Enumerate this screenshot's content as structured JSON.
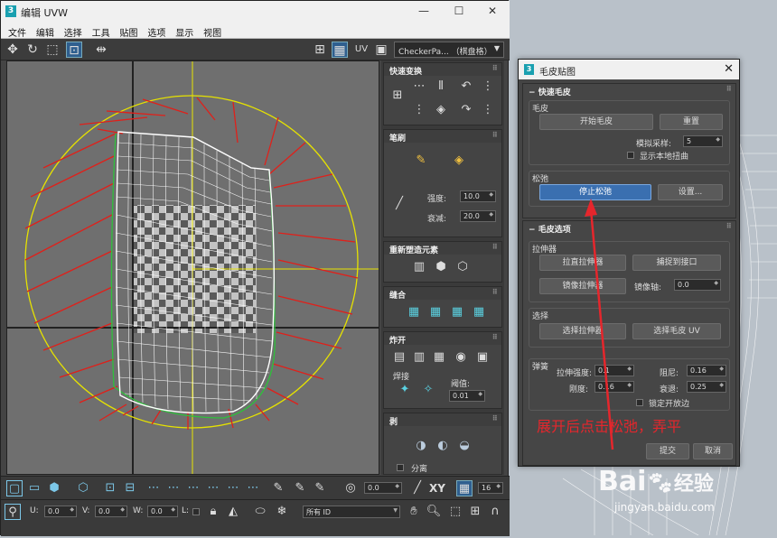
{
  "uvw": {
    "title": "编辑 UVW",
    "menu": [
      "文件",
      "编辑",
      "选择",
      "工具",
      "贴图",
      "选项",
      "显示",
      "视图"
    ],
    "toolbar": {
      "uv_label": "UV",
      "texture": "CheckerPa... （棋盘格）"
    }
  },
  "rollouts": {
    "quick_transform": "快速变换",
    "brush": "笔刷",
    "strength_label": "强度:",
    "strength_value": "10.0",
    "falloff_label": "衰减:",
    "falloff_value": "20.0",
    "rearrange": "重新塑造元素",
    "stitch": "缝合",
    "explode": "炸开",
    "weld_label": "焊接",
    "threshold_label": "阈值:",
    "threshold_value": "0.01",
    "peel": "剥",
    "detach_label": "分离"
  },
  "bottom": {
    "angle_value": "0.0",
    "xy_label": "XY",
    "grid_value": "16",
    "u_label": "U:",
    "u_value": "0.0",
    "v_label": "V:",
    "v_value": "0.0",
    "w_label": "W:",
    "w_value": "0.0",
    "l_label": "L:",
    "id_select": "所有 ID"
  },
  "peel_dialog": {
    "title": "毛皮贴图",
    "quick_section": "快速毛皮",
    "pelt_group": "毛皮",
    "start_pelt": "开始毛皮",
    "reset": "重置",
    "sim_samples_label": "模拟采样:",
    "sim_samples_value": "5",
    "show_local_distort": "显示本地扭曲",
    "relax_group": "松弛",
    "stop_relax": "停止松弛",
    "settings": "设置...",
    "options_section": "毛皮选项",
    "stretcher_group": "拉伸器",
    "straighten_stretcher": "拉直拉伸器",
    "snap_to_seam": "捕捉到接口",
    "mirror_stretcher": "镜像拉伸器",
    "mirror_axis_label": "镜像轴:",
    "mirror_axis_value": "0.0",
    "select_group": "选择",
    "select_stretcher": "选择拉伸器",
    "select_pelt_uv": "选择毛皮 UV",
    "spring_group": "弹簧",
    "stretcher_strength_label": "拉伸强度:",
    "stretcher_strength_value": "0.1",
    "damping_label": "阻尼:",
    "damping_value": "0.16",
    "stiffness_label": "刚度:",
    "stiffness_value": "0.16",
    "decay_label": "衰退:",
    "decay_value": "0.25",
    "lock_open_edges": "锁定开放边",
    "commit": "提交",
    "cancel": "取消"
  },
  "annotation": "展开后点击松弛，弄平",
  "watermark": {
    "brand": "Bai",
    "brand2": "经验",
    "url": "jingyan.baidu.com"
  }
}
